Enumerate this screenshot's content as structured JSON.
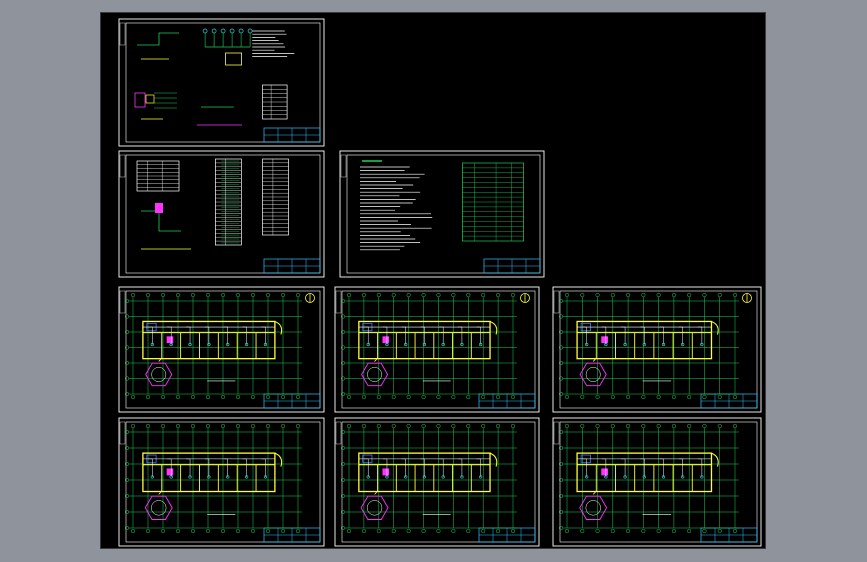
{
  "app": {
    "window_title": "",
    "canvas_background": "#000000",
    "workspace_background": "#8f939b"
  },
  "colors": {
    "frame": "#ffffff",
    "grid": "#1fd15a",
    "wall": "#ffff33",
    "wire": "#ffffff",
    "accent_blue": "#4f6cff",
    "accent_magenta": "#ff33ff",
    "accent_cyan": "#25e0e0",
    "title_block": "#33c3ff"
  },
  "sheets": [
    {
      "id": "sheet-electrical-diagrams",
      "kind": "system-diagram"
    },
    {
      "id": "sheet-distribution-schedule",
      "kind": "schedule"
    },
    {
      "id": "sheet-design-notes",
      "kind": "notes"
    },
    {
      "id": "sheet-floor-1-lighting",
      "kind": "floor-plan",
      "has_compass": true,
      "has_hexagon": true
    },
    {
      "id": "sheet-floor-2-lighting",
      "kind": "floor-plan",
      "has_compass": true,
      "has_hexagon": true
    },
    {
      "id": "sheet-floor-3-lighting",
      "kind": "floor-plan",
      "has_compass": true,
      "has_hexagon": true
    },
    {
      "id": "sheet-floor-1-power",
      "kind": "floor-plan",
      "has_compass": false,
      "has_hexagon": true
    },
    {
      "id": "sheet-floor-2-power",
      "kind": "floor-plan",
      "has_compass": false,
      "has_hexagon": true
    },
    {
      "id": "sheet-floor-3-power",
      "kind": "floor-plan",
      "has_compass": false,
      "has_hexagon": true
    }
  ]
}
